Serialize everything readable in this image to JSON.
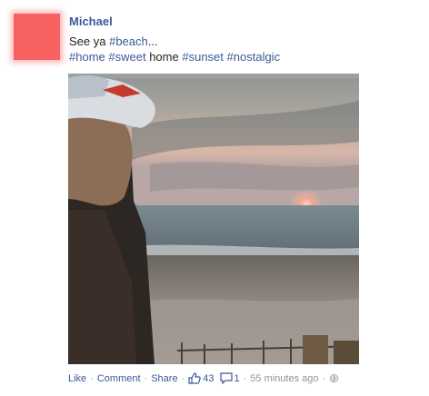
{
  "post": {
    "author": "Michael",
    "status_prefix": "See ya ",
    "tag_beach": "#beach",
    "status_suffix": "...",
    "tag_home": "#home",
    "tag_sweet": "#sweet",
    "plain_home": "home",
    "tag_sunset": "#sunset",
    "tag_nostalgic": "#nostalgic"
  },
  "footer": {
    "like_label": "Like",
    "separator": "·",
    "comment_label": "Comment",
    "share_label": "Share",
    "like_count": "43",
    "comment_count": "1",
    "timestamp": "55 minutes ago",
    "like_icon": "thumbs-up-icon",
    "comment_icon": "speech-bubble-icon",
    "audience_icon": "globe-icon"
  },
  "colors": {
    "link": "#3b5998",
    "meta": "#90949c",
    "avatar": "#f86161"
  }
}
